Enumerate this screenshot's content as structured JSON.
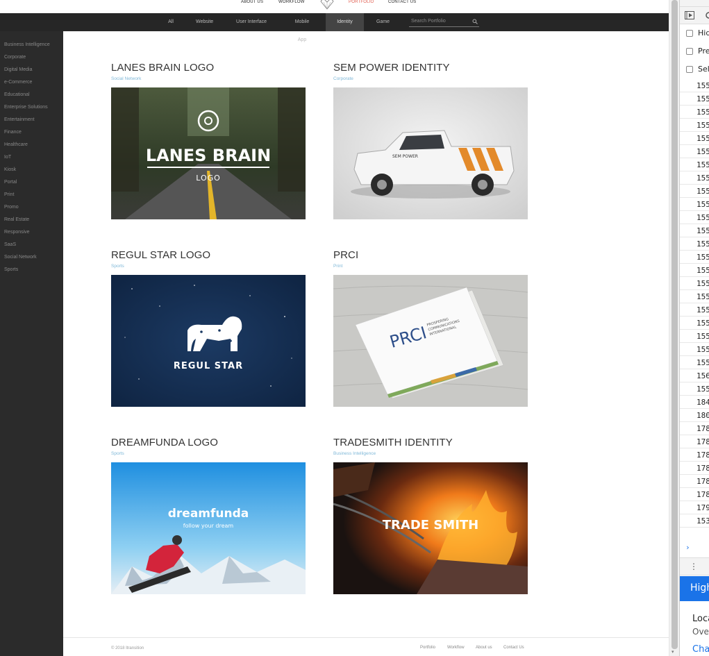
{
  "header": {
    "nav": [
      {
        "label": "ABOUT US"
      },
      {
        "label": "WORKFLOW"
      },
      {
        "label": "PORTFOLIO"
      },
      {
        "label": "CONTACT US"
      }
    ]
  },
  "filters": {
    "tabs": [
      {
        "label": "All"
      },
      {
        "label": "Website"
      },
      {
        "label": "User Interface"
      },
      {
        "label": "Mobile App"
      },
      {
        "label": "Identity"
      },
      {
        "label": "Game"
      }
    ],
    "active": "Identity",
    "search_placeholder": "Search Portfolio"
  },
  "sidebar": {
    "items": [
      {
        "label": "Business Intelligence"
      },
      {
        "label": "Corporate"
      },
      {
        "label": "Digital Media"
      },
      {
        "label": "e-Commerce"
      },
      {
        "label": "Educational"
      },
      {
        "label": "Enterprise Solutions"
      },
      {
        "label": "Entertainment"
      },
      {
        "label": "Finance"
      },
      {
        "label": "Healthcare"
      },
      {
        "label": "IoT"
      },
      {
        "label": "Kiosk"
      },
      {
        "label": "Portal"
      },
      {
        "label": "Print"
      },
      {
        "label": "Promo"
      },
      {
        "label": "Real Estate"
      },
      {
        "label": "Responsive"
      },
      {
        "label": "SaaS"
      },
      {
        "label": "Social Network"
      },
      {
        "label": "Sports"
      }
    ]
  },
  "portfolio": {
    "items": [
      {
        "title": "LANES BRAIN LOGO",
        "category": "Social Network",
        "image_text": "LANES BRAIN",
        "image_sub": "LOGO"
      },
      {
        "title": "SEM POWER IDENTITY",
        "category": "Corporate",
        "image_text": "SEM POWER",
        "image_sub": ""
      },
      {
        "title": "REGUL STAR LOGO",
        "category": "Sports",
        "image_text": "REGUL STAR",
        "image_sub": ""
      },
      {
        "title": "PRCI",
        "category": "Print",
        "image_text": "PRCI",
        "image_sub": "PROSPERING COMMUNICATIONS INTERNATIONAL"
      },
      {
        "title": "DREAMFUNDA LOGO",
        "category": "Sports",
        "image_text": "dreamfunda",
        "image_sub": "follow your dream"
      },
      {
        "title": "TRADESMITH IDENTITY",
        "category": "Business Intelligence",
        "image_text": "TRADE SMITH",
        "image_sub": ""
      }
    ]
  },
  "footer": {
    "copyright": "© 2018 Itransition",
    "links": [
      {
        "label": "Portfolio"
      },
      {
        "label": "Workflow"
      },
      {
        "label": "About us"
      },
      {
        "label": "Contact Us"
      }
    ]
  },
  "devtools": {
    "checkboxes": [
      {
        "label": "Hid"
      },
      {
        "label": "Pre"
      },
      {
        "label": "Sel"
      }
    ],
    "rows": [
      "155",
      "155",
      "155",
      "155",
      "155",
      "155",
      "155",
      "155",
      "155",
      "155",
      "155",
      "155",
      "155",
      "155",
      "155",
      "155",
      "155",
      "155",
      "155",
      "155",
      "155",
      "155",
      "156",
      "155",
      "184",
      "180",
      "178",
      "178",
      "178",
      "178",
      "178",
      "178",
      "179",
      "153"
    ],
    "blue_label": "High",
    "loc_label": "Loca",
    "ove_label": "Ove",
    "cha_label": "Cha"
  },
  "colors": {
    "accent": "#e05a4c",
    "category": "#7fb8d8",
    "sidebar_bg": "#2b2b2b",
    "filterbar_bg": "#262626"
  }
}
